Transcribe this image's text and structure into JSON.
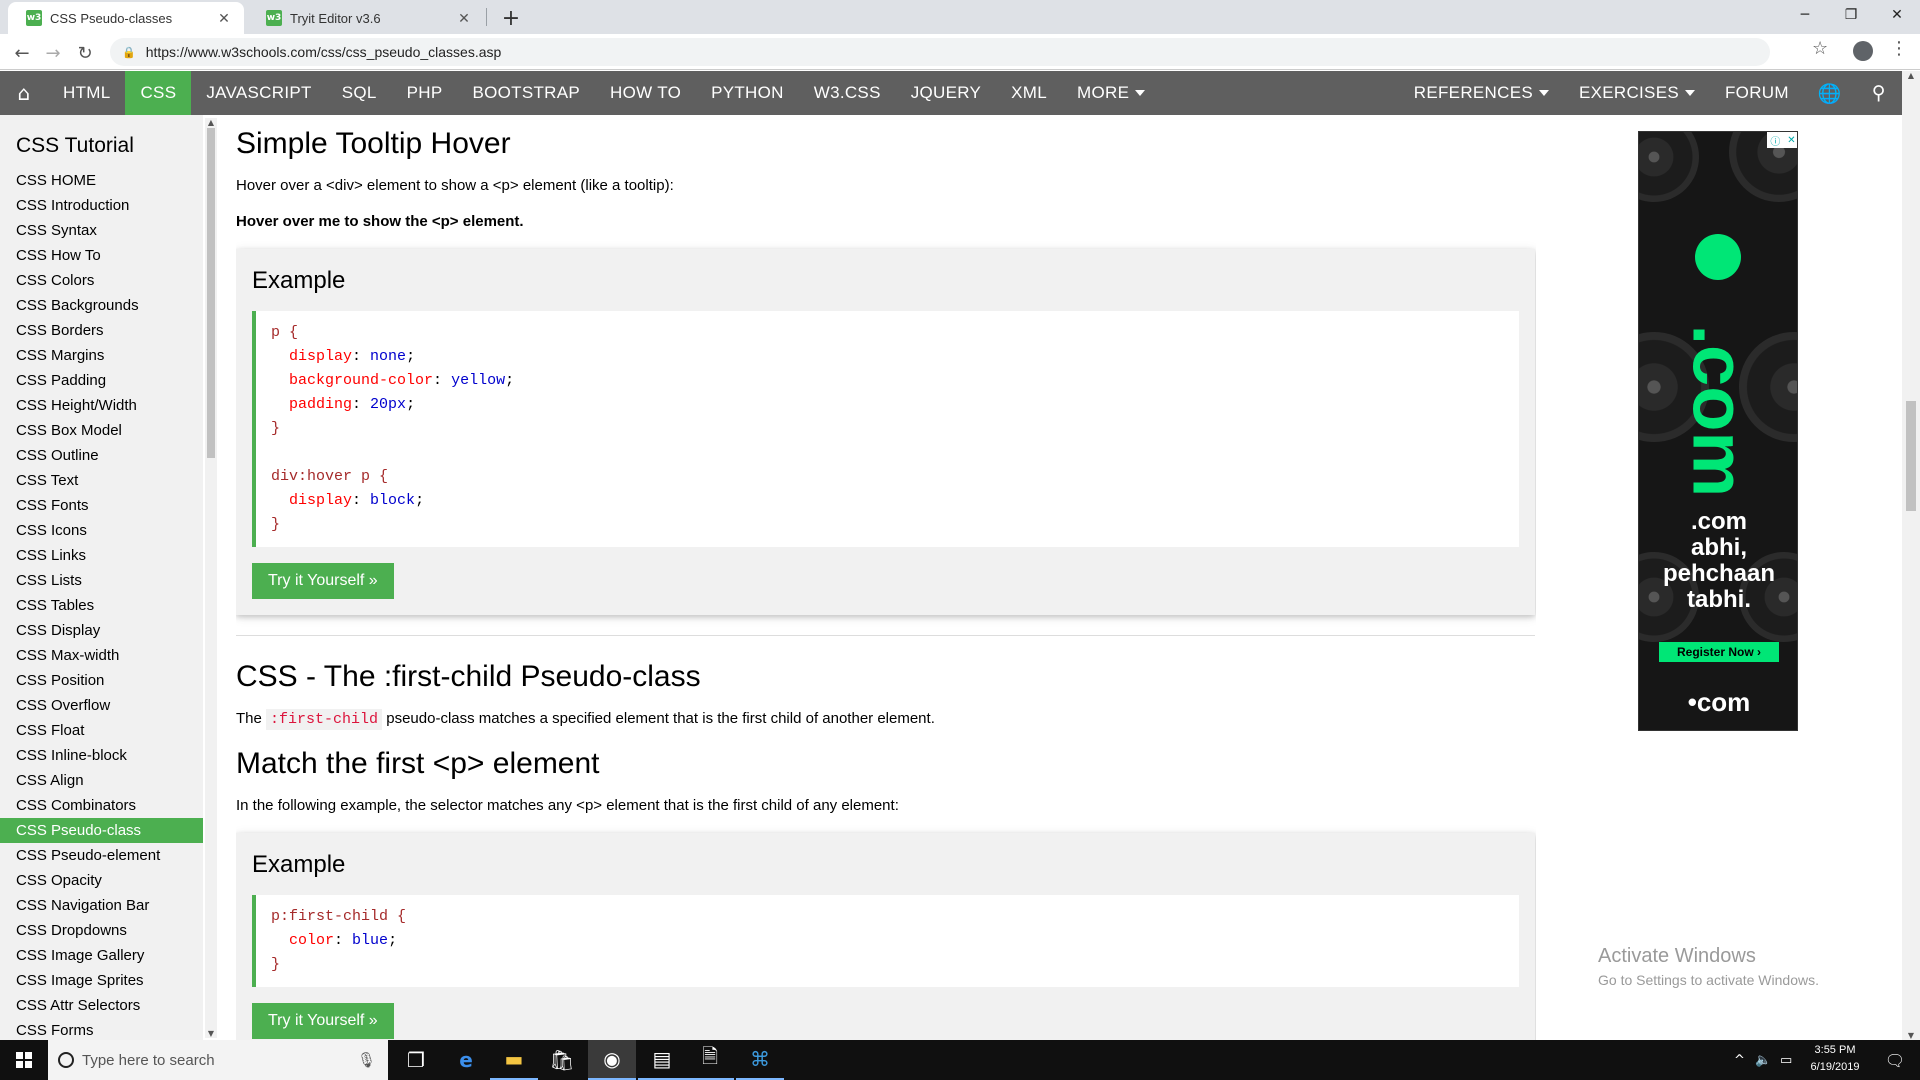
{
  "browser": {
    "tabs": [
      {
        "title": "CSS Pseudo-classes",
        "favicon": "w3"
      },
      {
        "title": "Tryit Editor v3.6",
        "favicon": "w3"
      }
    ],
    "url": "https://www.w3schools.com/css/css_pseudo_classes.asp",
    "window_controls": {
      "minimize": "─",
      "restore": "❐",
      "close": "✕"
    }
  },
  "topnav": {
    "home_icon": "home-icon",
    "items": [
      "HTML",
      "CSS",
      "JAVASCRIPT",
      "SQL",
      "PHP",
      "BOOTSTRAP",
      "HOW TO",
      "PYTHON",
      "W3.CSS",
      "JQUERY",
      "XML"
    ],
    "more": "MORE",
    "right_items": [
      "REFERENCES",
      "EXERCISES"
    ],
    "forum": "FORUM",
    "active_color": "#4caf50"
  },
  "sidebar": {
    "title": "CSS Tutorial",
    "active": "CSS Pseudo-class",
    "items": [
      "CSS HOME",
      "CSS Introduction",
      "CSS Syntax",
      "CSS How To",
      "CSS Colors",
      "CSS Backgrounds",
      "CSS Borders",
      "CSS Margins",
      "CSS Padding",
      "CSS Height/Width",
      "CSS Box Model",
      "CSS Outline",
      "CSS Text",
      "CSS Fonts",
      "CSS Icons",
      "CSS Links",
      "CSS Lists",
      "CSS Tables",
      "CSS Display",
      "CSS Max-width",
      "CSS Position",
      "CSS Overflow",
      "CSS Float",
      "CSS Inline-block",
      "CSS Align",
      "CSS Combinators",
      "CSS Pseudo-class",
      "CSS Pseudo-element",
      "CSS Opacity",
      "CSS Navigation Bar",
      "CSS Dropdowns",
      "CSS Image Gallery",
      "CSS Image Sprites",
      "CSS Attr Selectors",
      "CSS Forms"
    ]
  },
  "main": {
    "section1": {
      "heading": "Simple Tooltip Hover",
      "intro": "Hover over a <div> element to show a <p> element (like a tooltip):",
      "demo": "Hover over me to show the <p> element.",
      "example_title": "Example",
      "code": {
        "rule1_selector": "p {",
        "rule1_props": [
          {
            "prop": "display",
            "val": "none"
          },
          {
            "prop": "background-color",
            "val": "yellow"
          },
          {
            "prop": "padding",
            "val": "20px"
          }
        ],
        "close": "}",
        "rule2_selector": "div:hover p {",
        "rule2_props": [
          {
            "prop": "display",
            "val": "block"
          }
        ]
      },
      "try_button": "Try it Yourself »"
    },
    "section2": {
      "heading": "CSS - The :first-child Pseudo-class",
      "text_before": "The",
      "code_word": ":first-child",
      "text_after": "pseudo-class matches a specified element that is the first child of another element."
    },
    "section3": {
      "heading": "Match the first <p> element",
      "intro": "In the following example, the selector matches any <p> element that is the first child of any element:",
      "example_title": "Example",
      "code": {
        "selector": "p:first-child {",
        "props": [
          {
            "prop": "color",
            "val": "blue"
          }
        ],
        "close": "}"
      }
    }
  },
  "ad": {
    "big_text": ".com",
    "tagline_lines": [
      ".com",
      "abhi,",
      "pehchaan",
      "tabhi."
    ],
    "register": "Register Now",
    "footer": "•com",
    "accent": "#00e676"
  },
  "watermark": {
    "line1": "Activate Windows",
    "line2": "Go to Settings to activate Windows."
  },
  "taskbar": {
    "search_placeholder": "Type here to search",
    "time": "3:55 PM",
    "date": "6/19/2019"
  }
}
